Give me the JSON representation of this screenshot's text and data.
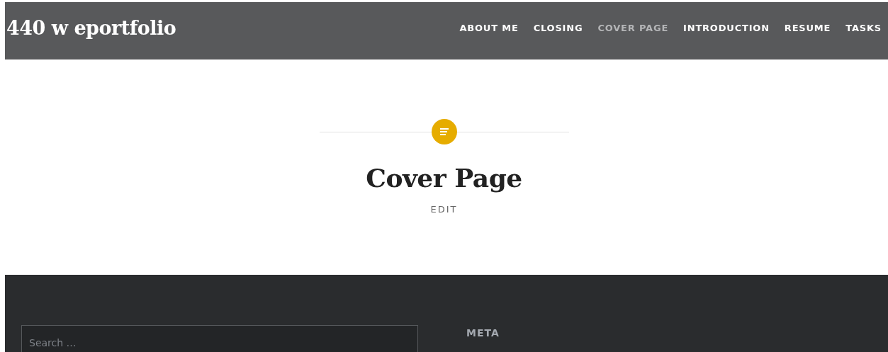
{
  "site": {
    "title": "440 w eportfolio"
  },
  "nav": [
    {
      "label": "ABOUT ME",
      "selected": false
    },
    {
      "label": "CLOSING",
      "selected": false
    },
    {
      "label": "COVER PAGE",
      "selected": true
    },
    {
      "label": "INTRODUCTION",
      "selected": false
    },
    {
      "label": "RESUME",
      "selected": false
    },
    {
      "label": "TASKS",
      "selected": false
    }
  ],
  "page": {
    "title": "Cover Page",
    "edit_link": "EDIT"
  },
  "footer": {
    "search": {
      "placeholder": "Search …"
    },
    "widget_title": "META"
  }
}
